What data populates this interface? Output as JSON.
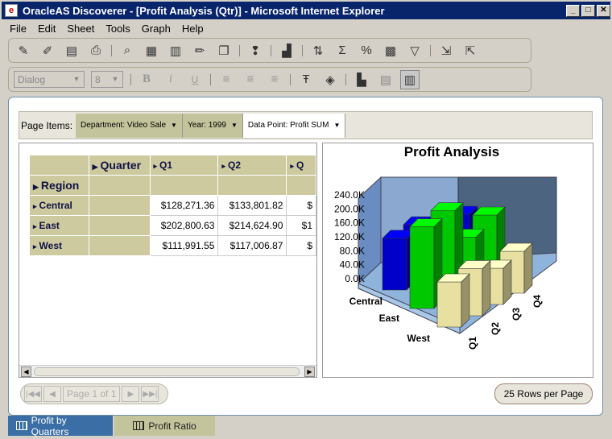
{
  "window": {
    "title": "OracleAS Discoverer - [Profit Analysis (Qtr)] - Microsoft Internet Explorer"
  },
  "menu": [
    "File",
    "Edit",
    "Sheet",
    "Tools",
    "Graph",
    "Help"
  ],
  "format_toolbar": {
    "font": "Dialog",
    "size": "8",
    "bold": "B",
    "italic": "i",
    "underline": "U"
  },
  "page_items": {
    "label": "Page Items:",
    "items": [
      "Department:  Video Sale",
      "Year:  1999",
      "Data Point:  Profit SUM"
    ]
  },
  "table": {
    "col_header": "Quarter",
    "row_header": "Region",
    "columns": [
      "Q1",
      "Q2",
      "Q"
    ],
    "rows": [
      {
        "label": "Central",
        "values": [
          "$128,271.36",
          "$133,801.82",
          "$"
        ]
      },
      {
        "label": "East",
        "values": [
          "$202,800.63",
          "$214,624.90",
          "$1"
        ]
      },
      {
        "label": "West",
        "values": [
          "$111,991.55",
          "$117,006.87",
          "$"
        ]
      }
    ]
  },
  "chart_data": {
    "type": "bar",
    "title": "Profit Analysis",
    "y_ticks": [
      "240.0K",
      "200.0K",
      "160.0K",
      "120.0K",
      "80.0K",
      "40.0K",
      "0.0K"
    ],
    "ylim": [
      0,
      240000
    ],
    "categories": [
      "Q1",
      "Q2",
      "Q3",
      "Q4"
    ],
    "series_axis": [
      "Central",
      "East",
      "West"
    ],
    "series": [
      {
        "name": "Central",
        "color": "#0000c8",
        "values": [
          128271.36,
          133801.82,
          96000,
          104000
        ]
      },
      {
        "name": "East",
        "color": "#00c800",
        "values": [
          202800.63,
          214624.9,
          121000,
          148000
        ]
      },
      {
        "name": "West",
        "color": "#e8e0a0",
        "values": [
          111991.55,
          117006.87,
          90000,
          104000
        ]
      }
    ]
  },
  "pager": {
    "first": "|◀◀",
    "prev": "◀",
    "page": "Page 1 of 1",
    "next": "▶",
    "last": "▶▶|"
  },
  "rows_per_page": "25 Rows per Page",
  "tabs": [
    "Profit by Quarters",
    "Profit Ratio"
  ]
}
